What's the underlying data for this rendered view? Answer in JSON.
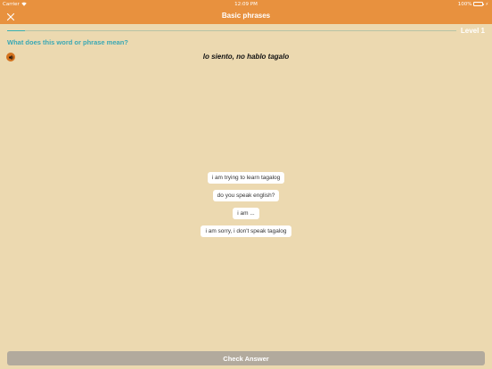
{
  "status_bar": {
    "carrier": "Carrier",
    "time": "12:09 PM",
    "battery_percent": "100%",
    "battery_level": 1.0,
    "wifi_icon": "wifi-icon",
    "battery_icon": "battery-icon"
  },
  "nav": {
    "title": "Basic phrases",
    "close_icon": "close-icon"
  },
  "level": {
    "label": "Level 1",
    "progress_fraction": 0.04
  },
  "question": {
    "prompt": "What does this word or phrase mean?",
    "phrase": "lo siento, no hablo tagalo",
    "speaker_icon": "speaker-icon"
  },
  "options": [
    {
      "label": "i am trying to learn tagalog"
    },
    {
      "label": "do you speak english?"
    },
    {
      "label": "i am ..."
    },
    {
      "label": "i am sorry, i don't speak tagalog"
    }
  ],
  "actions": {
    "check_answer": "Check Answer"
  },
  "colors": {
    "header": "#e8913e",
    "background": "#ecd9b0",
    "accent": "#3aa8b4",
    "button_disabled": "#b2aa9d"
  }
}
